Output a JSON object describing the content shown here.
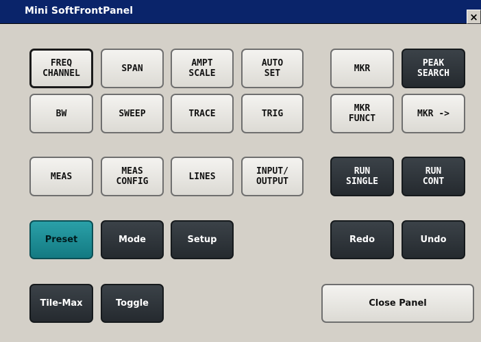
{
  "window": {
    "title": "Mini SoftFrontPanel",
    "close_glyph": "×",
    "close_icon": "close-icon"
  },
  "buttons": {
    "freq_channel": "FREQ\nCHANNEL",
    "span": "SPAN",
    "ampt_scale": "AMPT\nSCALE",
    "auto_set": "AUTO\nSET",
    "mkr": "MKR",
    "peak_search": "PEAK\nSEARCH",
    "bw": "BW",
    "sweep": "SWEEP",
    "trace": "TRACE",
    "trig": "TRIG",
    "mkr_funct": "MKR\nFUNCT",
    "mkr_arrow": "MKR ->",
    "meas": "MEAS",
    "meas_config": "MEAS\nCONFIG",
    "lines": "LINES",
    "input_output": "INPUT/\nOUTPUT",
    "run_single": "RUN\nSINGLE",
    "run_cont": "RUN\nCONT",
    "preset": "Preset",
    "mode": "Mode",
    "setup": "Setup",
    "redo": "Redo",
    "undo": "Undo",
    "tile_max": "Tile-Max",
    "toggle": "Toggle",
    "close_panel": "Close Panel"
  },
  "colors": {
    "titlebar": "#0a246a",
    "panel_bg": "#d4d0c8",
    "light_button": "#e8e7e3",
    "dark_button": "#2e3439",
    "preset_button": "#1f8f97"
  }
}
